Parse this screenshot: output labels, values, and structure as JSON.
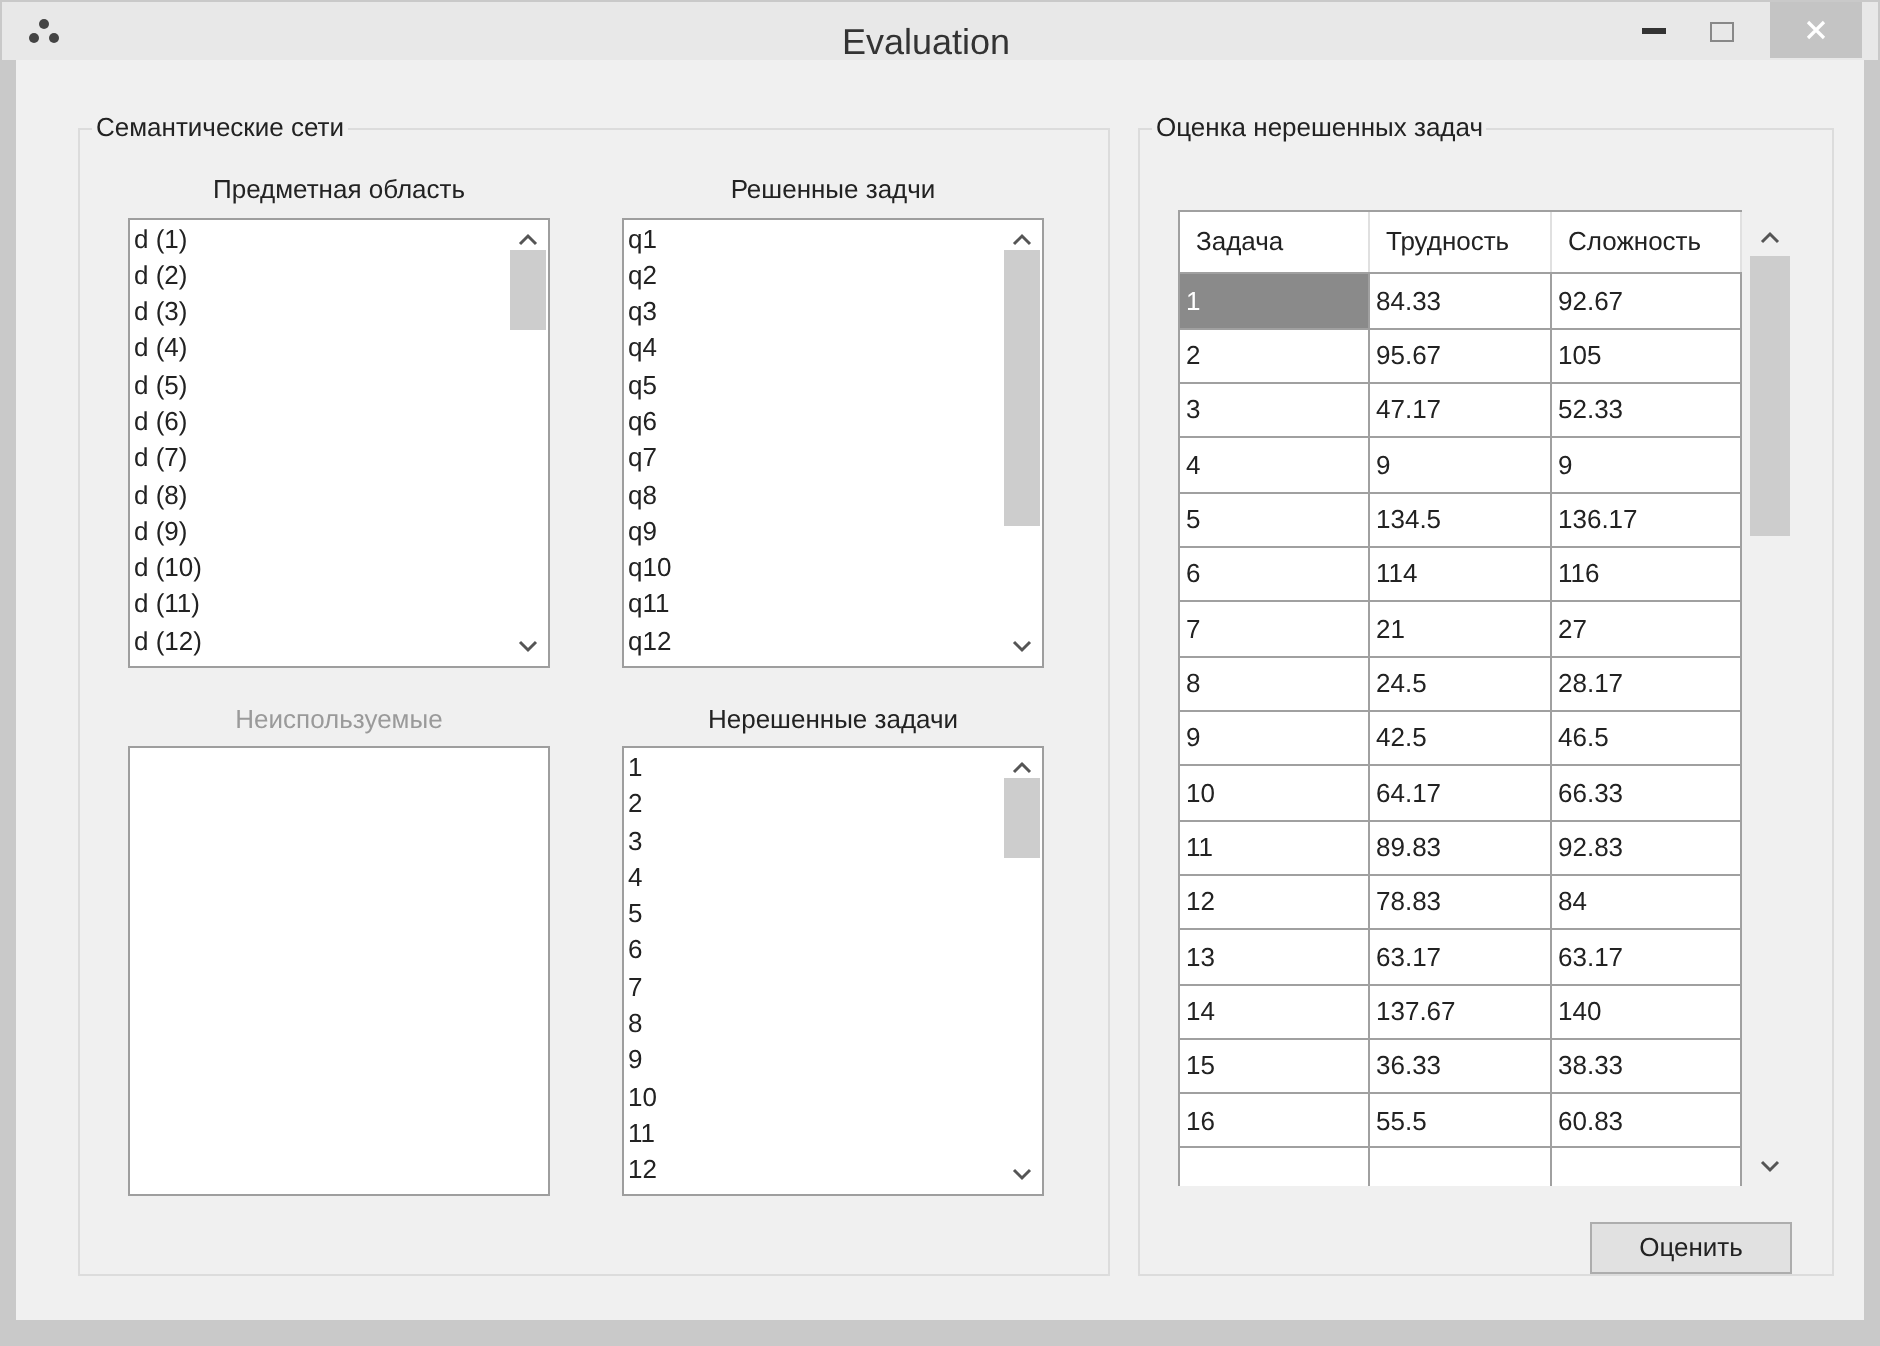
{
  "window": {
    "title": "Evaluation"
  },
  "semantic_group": {
    "title": "Семантические сети",
    "lists": [
      {
        "label": "Предметная область",
        "disabled": false,
        "items": [
          "d (1)",
          "d (2)",
          "d (3)",
          "d (4)",
          "d (5)",
          "d (6)",
          "d (7)",
          "d (8)",
          "d (9)",
          "d (10)",
          "d (11)",
          "d (12)"
        ]
      },
      {
        "label": "Решенные задчи",
        "disabled": false,
        "items": [
          "q1",
          "q2",
          "q3",
          "q4",
          "q5",
          "q6",
          "q7",
          "q8",
          "q9",
          "q10",
          "q11",
          "q12"
        ]
      },
      {
        "label": "Неиспользуемые",
        "disabled": true
      },
      {
        "label": "Нерешенные задачи",
        "disabled": false,
        "items": [
          "1",
          "2",
          "3",
          "4",
          "5",
          "6",
          "7",
          "8",
          "9",
          "10",
          "11",
          "12"
        ]
      }
    ]
  },
  "evaluation_group": {
    "title": "Оценка нерешенных задач",
    "table": {
      "columns": [
        "Задача",
        "Трудность",
        "Сложность"
      ],
      "rows": [
        {
          "cells": [
            "1",
            "84.33",
            "92.67"
          ],
          "selected": true
        },
        {
          "cells": [
            "2",
            "95.67",
            "105"
          ],
          "selected": false
        },
        {
          "cells": [
            "3",
            "47.17",
            "52.33"
          ],
          "selected": false
        },
        {
          "cells": [
            "4",
            "9",
            "9"
          ],
          "selected": false
        },
        {
          "cells": [
            "5",
            "134.5",
            "136.17"
          ],
          "selected": false
        },
        {
          "cells": [
            "6",
            "114",
            "116"
          ],
          "selected": false
        },
        {
          "cells": [
            "7",
            "21",
            "27"
          ],
          "selected": false
        },
        {
          "cells": [
            "8",
            "24.5",
            "28.17"
          ],
          "selected": false
        },
        {
          "cells": [
            "9",
            "42.5",
            "46.5"
          ],
          "selected": false
        },
        {
          "cells": [
            "10",
            "64.17",
            "66.33"
          ],
          "selected": false
        },
        {
          "cells": [
            "11",
            "89.83",
            "92.83"
          ],
          "selected": false
        },
        {
          "cells": [
            "12",
            "78.83",
            "84"
          ],
          "selected": false
        },
        {
          "cells": [
            "13",
            "63.17",
            "63.17"
          ],
          "selected": false
        },
        {
          "cells": [
            "14",
            "137.67",
            "140"
          ],
          "selected": false
        },
        {
          "cells": [
            "15",
            "36.33",
            "38.33"
          ],
          "selected": false
        },
        {
          "cells": [
            "16",
            "55.5",
            "60.83"
          ],
          "selected": false
        }
      ]
    },
    "button": "Оценить"
  }
}
